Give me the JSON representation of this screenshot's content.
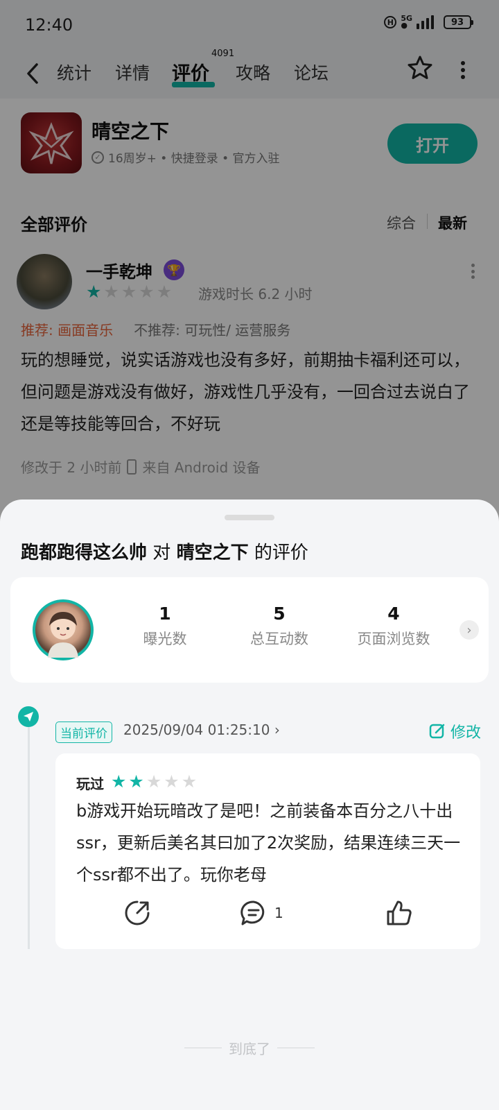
{
  "status_bar": {
    "time": "12:40",
    "network": "5G",
    "battery": "93"
  },
  "nav": {
    "tabs": [
      "统计",
      "详情",
      "评价",
      "攻略",
      "论坛"
    ],
    "active_tab": "评价",
    "review_count": "4091"
  },
  "app": {
    "name": "晴空之下",
    "meta": "16周岁+ • 快捷登录 • 官方入驻",
    "open_label": "打开"
  },
  "reviews_section": {
    "title": "全部评价",
    "sort_options": [
      "综合",
      "最新"
    ],
    "active_sort": "最新"
  },
  "review": {
    "username": "一手乾坤",
    "rating": 1,
    "max_rating": 5,
    "play_time": "游戏时长 6.2 小时",
    "recommend": "推荐: 画面音乐",
    "not_recommend": "不推荐: 可玩性/ 运营服务",
    "content": "玩的想睡觉，说实话游戏也没有多好，前期抽卡福利还可以，但问题是游戏没有做好，游戏性几乎没有，一回合过去说白了还是等技能等回合，不好玩",
    "modified": "修改于 2 小时前",
    "source": "来自 Android 设备"
  },
  "sheet": {
    "user": "跑都跑得这么帅",
    "middle": "对",
    "game": "晴空之下",
    "suffix": "的评价",
    "stats": [
      {
        "value": "1",
        "label": "曝光数"
      },
      {
        "value": "5",
        "label": "总互动数"
      },
      {
        "value": "4",
        "label": "页面浏览数"
      }
    ],
    "current_tag": "当前评价",
    "timestamp": "2025/09/04 01:25:10",
    "edit_label": "修改",
    "played_label": "玩过",
    "my_rating": 2,
    "my_content": "b游戏开始玩暗改了是吧！之前装备本百分之八十出ssr，更新后美名其曰加了2次奖励，结果连续三天一个ssr都不出了。玩你老母",
    "comment_count": "1",
    "end_text": "到底了"
  },
  "colors": {
    "accent": "#12b5a6",
    "star_filled": "#12b5a6",
    "star_empty": "#d8d8d8",
    "recommend": "#e9643b"
  }
}
